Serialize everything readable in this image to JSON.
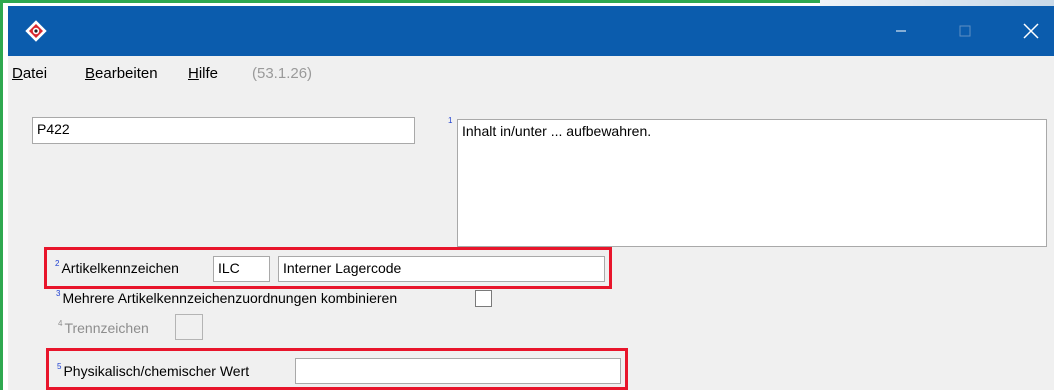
{
  "window": {
    "title_icon": "app-logo-icon",
    "controls": {
      "minimize_icon": "minimize-icon",
      "maximize_icon": "maximize-icon",
      "close_icon": "close-icon"
    }
  },
  "menu": {
    "items": [
      {
        "accel": "D",
        "rest": "atei"
      },
      {
        "accel": "B",
        "rest": "earbeiten"
      },
      {
        "accel": "H",
        "rest": "ilfe"
      }
    ],
    "version": "(53.1.26)"
  },
  "form": {
    "code_value": "P422",
    "text_marker": "1",
    "text_value": "Inhalt in/unter ... aufbewahren.",
    "artikel": {
      "marker": "2",
      "label": "Artikelkennzeichen",
      "code": "ILC",
      "description": "Interner Lagercode"
    },
    "mehrere": {
      "marker": "3",
      "label": "Mehrere Artikelkennzeichenzuordnungen kombinieren",
      "checked": false
    },
    "trenn": {
      "marker": "4",
      "label": "Trennzeichen",
      "value": ""
    },
    "physik": {
      "marker": "5",
      "label": "Physikalisch/chemischer Wert",
      "value": ""
    }
  },
  "colors": {
    "titlebar": "#0b5cad",
    "highlight": "#e8152b",
    "window_bg": "#f0f0f0",
    "marker": "#1d3fd1"
  }
}
